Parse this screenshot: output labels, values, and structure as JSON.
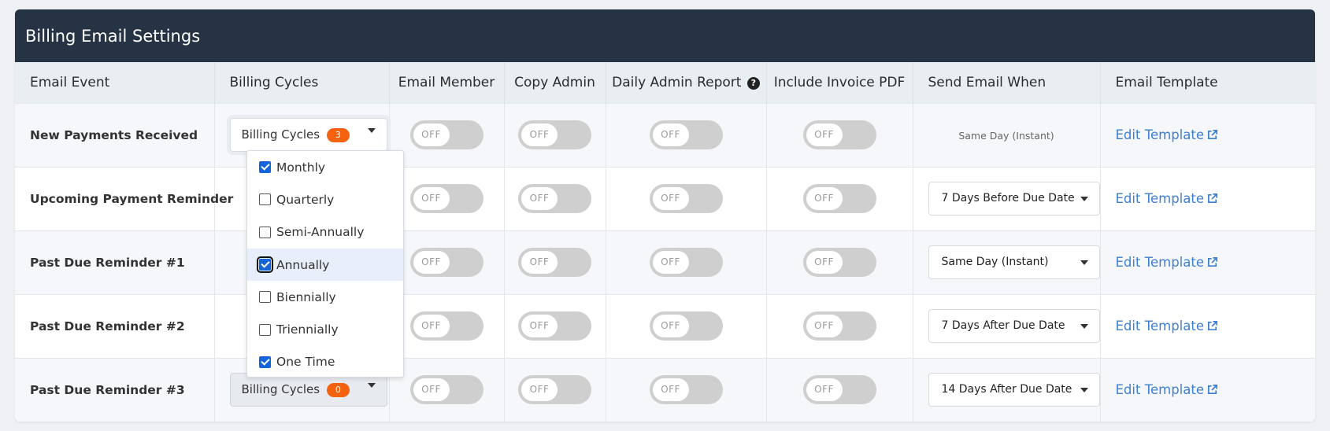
{
  "panel": {
    "title": "Billing Email Settings"
  },
  "columns": {
    "email_event": "Email Event",
    "billing_cycles": "Billing Cycles",
    "email_member": "Email Member",
    "copy_admin": "Copy Admin",
    "daily_admin_report": "Daily Admin Report",
    "include_invoice_pdf": "Include Invoice PDF",
    "send_email_when": "Send Email When",
    "email_template": "Email Template"
  },
  "toggle_off_label": "OFF",
  "billing_cycles_label": "Billing Cycles",
  "edit_template_label": "Edit Template",
  "rows": [
    {
      "event": "New Payments Received",
      "billing_cycles_count": "3",
      "send_when": "Same Day (Instant)"
    },
    {
      "event": "Upcoming Payment Reminder",
      "send_when": "7 Days Before Due Date"
    },
    {
      "event": "Past Due Reminder #1",
      "send_when": "Same Day (Instant)"
    },
    {
      "event": "Past Due Reminder #2",
      "send_when": "7 Days After Due Date"
    },
    {
      "event": "Past Due Reminder #3",
      "billing_cycles_count": "0",
      "send_when": "14 Days After Due Date"
    }
  ],
  "billing_cycle_options": [
    {
      "label": "Monthly",
      "checked": true
    },
    {
      "label": "Quarterly",
      "checked": false
    },
    {
      "label": "Semi-Annually",
      "checked": false
    },
    {
      "label": "Annually",
      "checked": true
    },
    {
      "label": "Biennially",
      "checked": false
    },
    {
      "label": "Triennially",
      "checked": false
    },
    {
      "label": "One Time",
      "checked": true
    }
  ],
  "colors": {
    "header_bg": "#253345",
    "badge": "#f5620f",
    "link": "#3f7fcf",
    "checkbox": "#1565d8"
  }
}
